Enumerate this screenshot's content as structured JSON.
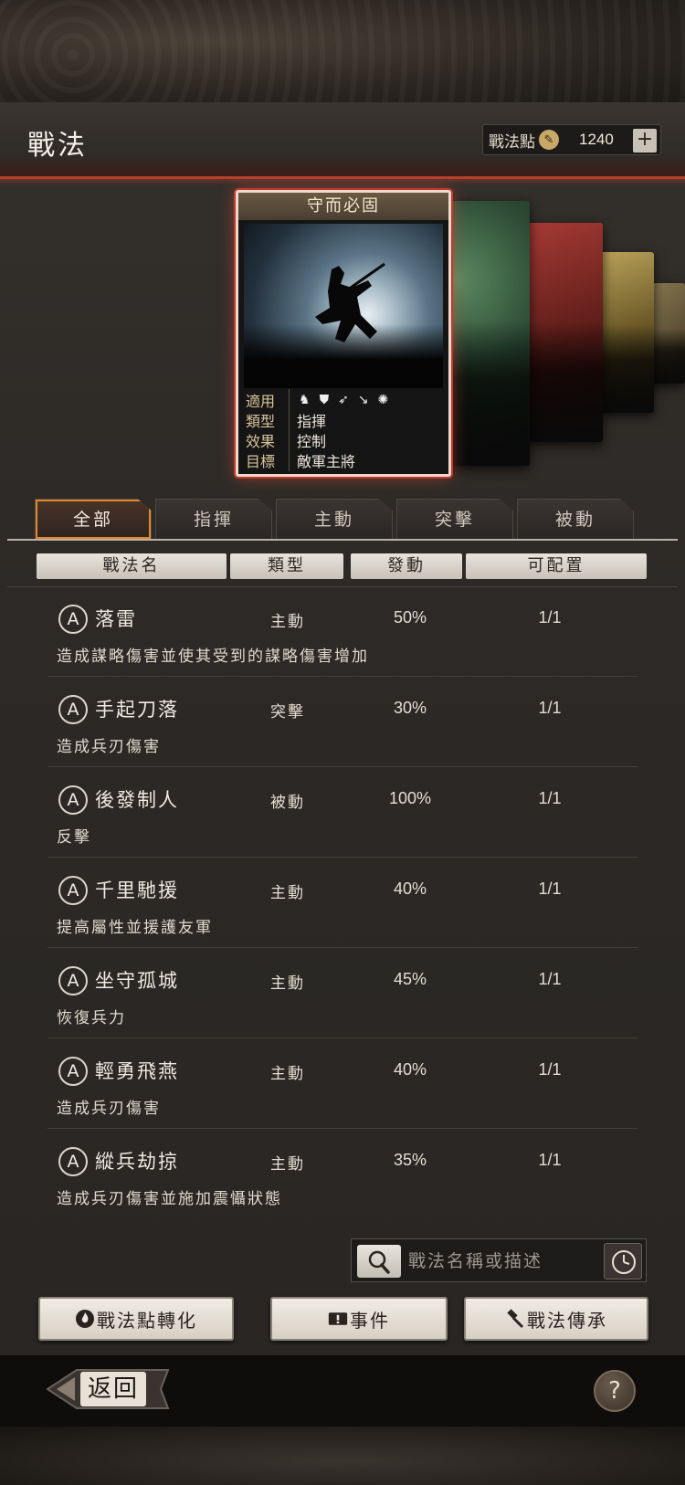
{
  "header": {
    "title": "戰法",
    "points_label": "戰法點",
    "points_value": "1240",
    "plus_label": "+"
  },
  "card": {
    "name": "守而必固",
    "stats": [
      {
        "key": "適用",
        "value": ""
      },
      {
        "key": "類型",
        "value": "指揮"
      },
      {
        "key": "效果",
        "value": "控制"
      },
      {
        "key": "目標",
        "value": "敵軍主將"
      }
    ],
    "applicable_icons": [
      "cavalry-icon",
      "shield-icon",
      "bow-icon",
      "spear-icon",
      "wheel-icon"
    ]
  },
  "tabs": [
    {
      "label": "全部",
      "active": true
    },
    {
      "label": "指揮",
      "active": false
    },
    {
      "label": "主動",
      "active": false
    },
    {
      "label": "突擊",
      "active": false
    },
    {
      "label": "被動",
      "active": false
    }
  ],
  "columns": [
    "戰法名",
    "類型",
    "發動",
    "可配置"
  ],
  "rows": [
    {
      "badge": "A",
      "name": "落雷",
      "type": "主動",
      "rate": "50%",
      "avail": "1/1",
      "desc": "造成謀略傷害並使其受到的謀略傷害增加"
    },
    {
      "badge": "A",
      "name": "手起刀落",
      "type": "突擊",
      "rate": "30%",
      "avail": "1/1",
      "desc": "造成兵刃傷害"
    },
    {
      "badge": "A",
      "name": "後發制人",
      "type": "被動",
      "rate": "100%",
      "avail": "1/1",
      "desc": "反擊"
    },
    {
      "badge": "A",
      "name": "千里馳援",
      "type": "主動",
      "rate": "40%",
      "avail": "1/1",
      "desc": "提高屬性並援護友軍"
    },
    {
      "badge": "A",
      "name": "坐守孤城",
      "type": "主動",
      "rate": "45%",
      "avail": "1/1",
      "desc": "恢復兵力"
    },
    {
      "badge": "A",
      "name": "輕勇飛燕",
      "type": "主動",
      "rate": "40%",
      "avail": "1/1",
      "desc": "造成兵刃傷害"
    },
    {
      "badge": "A",
      "name": "縱兵劫掠",
      "type": "主動",
      "rate": "35%",
      "avail": "1/1",
      "desc": "造成兵刃傷害並施加震懾狀態"
    }
  ],
  "search": {
    "placeholder": "戰法名稱或描述"
  },
  "actions": {
    "convert_label": "戰法點轉化",
    "events_label": "事件",
    "inherit_label": "戰法傳承"
  },
  "footer": {
    "back_label": "返回",
    "help_label": "?"
  },
  "colors": {
    "accent_red": "#c0392b",
    "tab_active_outline": "#e08a2a"
  }
}
